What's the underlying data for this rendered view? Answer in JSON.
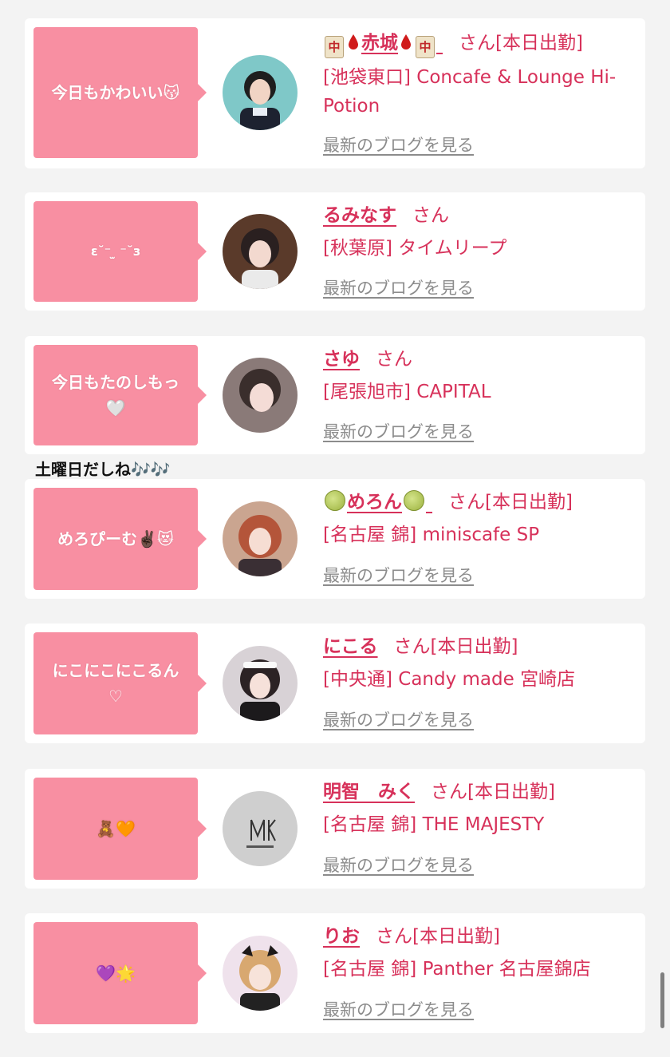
{
  "entries": [
    {
      "bubble": "今日もかわいい😽",
      "name_prefix_icon": "mahjong-chun-tile",
      "name": "赤城",
      "name_suffix_icon": "mahjong-chun-tile",
      "san": "さん",
      "status": "[本日出勤]",
      "shop": "[池袋東口] Concafe & Lounge Hi-Potion",
      "blog": "最新のブログを見る"
    },
    {
      "bubble": "ε˘⁻ ̫ ⁻˘з",
      "name": "るみなす",
      "san": "さん",
      "status": "",
      "shop": "[秋葉原] タイムリープ",
      "blog": "最新のブログを見る"
    },
    {
      "bubble": "今日もたのしもっ\n🤍",
      "name": "さゆ",
      "san": "さん",
      "status": "",
      "shop": "[尾張旭市] CAPITAL",
      "blog": "最新のブログを見る"
    },
    {
      "bubble": "めろぴーむ✌🏿😻",
      "name": "めろん",
      "san": "さん",
      "status": "[本日出勤]",
      "shop": "[名古屋 錦] miniscafe SP",
      "blog": "最新のブログを見る"
    },
    {
      "bubble": "にこにこにこるん\n♡",
      "name": "にこる",
      "san": "さん",
      "status": "[本日出勤]",
      "shop": "[中央通] Candy made 宮崎店",
      "blog": "最新のブログを見る"
    },
    {
      "bubble": "🧸🧡",
      "name": "明智　みく",
      "san": "さん",
      "status": "[本日出勤]",
      "shop": "[名古屋 錦] THE MAJESTY",
      "blog": "最新のブログを見る"
    },
    {
      "bubble": "💜🌟",
      "name": "りお",
      "san": "さん",
      "status": "[本日出勤]",
      "shop": "[名古屋 錦] Panther 名古屋錦店",
      "blog": "最新のブログを見る"
    }
  ],
  "between_text": "土曜日だしね🎶🎶",
  "colors": {
    "accent": "#d7315a",
    "bubble": "#f88fa2",
    "background": "#f3f3f3",
    "link_gray": "#8c8c8c"
  }
}
